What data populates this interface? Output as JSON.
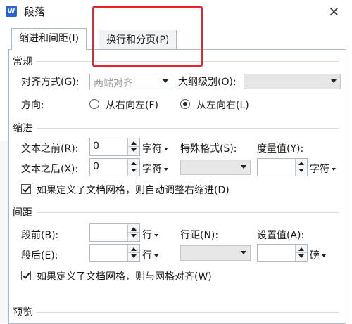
{
  "window": {
    "title": "段落",
    "app_icon_letter": "W",
    "close_symbol": "×"
  },
  "tabs": [
    {
      "label": "缩进和间距(I)",
      "active": true
    },
    {
      "label": "换行和分页(P)",
      "active": false
    }
  ],
  "general": {
    "section_title": "常规",
    "alignment_label": "对齐方式(G):",
    "alignment_value": "两端对齐",
    "outline_label": "大纲级别(O):",
    "outline_value": "",
    "direction_label": "方向:",
    "direction_options": [
      {
        "label": "从右向左(F)",
        "selected": false
      },
      {
        "label": "从左向右(L)",
        "selected": true
      }
    ]
  },
  "indent": {
    "section_title": "缩进",
    "before_label": "文本之前(R):",
    "before_value": "0",
    "before_unit": "字符",
    "after_label": "文本之后(X):",
    "after_value": "0",
    "after_unit": "字符",
    "special_label": "特殊格式(S):",
    "special_value": "",
    "measure_label": "度量值(Y):",
    "measure_value": "",
    "measure_unit": "字符",
    "grid_checkbox_label": "如果定义了文档网格，则自动调整右缩进(D)",
    "grid_checked": true
  },
  "spacing": {
    "section_title": "间距",
    "before_label": "段前(B):",
    "before_value": "",
    "before_unit": "行",
    "after_label": "段后(E):",
    "after_value": "",
    "after_unit": "行",
    "line_label": "行距(N):",
    "line_value": "",
    "setting_label": "设置值(A):",
    "setting_value": "",
    "setting_unit": "磅",
    "grid_checkbox_label": "如果定义了文档网格，则与网格对齐(W)",
    "grid_checked": true
  },
  "preview": {
    "section_title": "预览"
  },
  "colors": {
    "highlight_box": "#e3262a",
    "app_icon": "#2b64d6",
    "border": "#aeb7c2"
  }
}
